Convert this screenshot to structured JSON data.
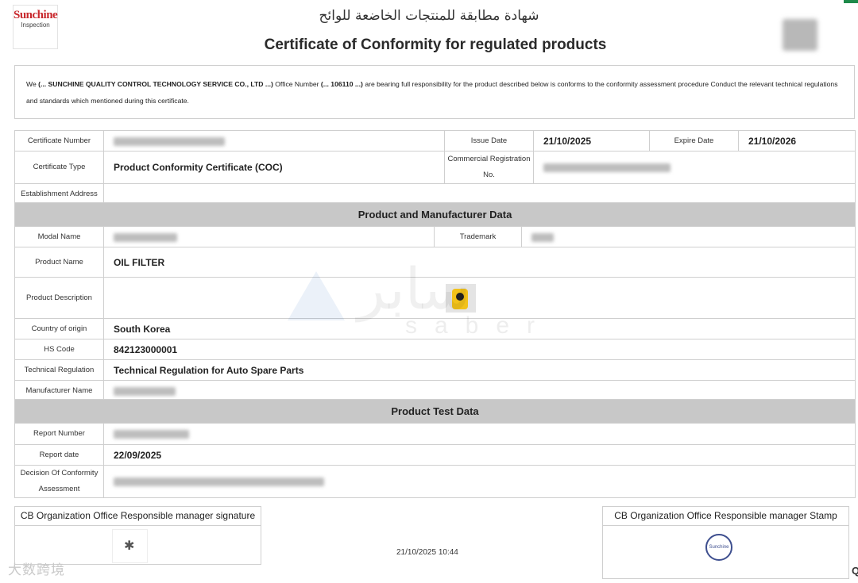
{
  "header": {
    "logo_line1": "Sunchine",
    "logo_line2": "Inspection",
    "title_ar": "شهادة مطابقة للمنتجات الخاضعة للوائح",
    "title_en": "Certificate of Conformity for regulated products"
  },
  "intro": {
    "we": "We",
    "company": "(... SUNCHINE QUALITY CONTROL TECHNOLOGY SERVICE CO., LTD ...)",
    "office_label": "Office Number",
    "office_number": "(... 106110 ...)",
    "text_rest": "are bearing full responsibility for the product described below is conforms to the conformity assessment procedure Conduct the relevant technical regulations and standards which mentioned during this certificate."
  },
  "certificate": {
    "number_label": "Certificate Number",
    "issue_date_label": "Issue Date",
    "issue_date": "21/10/2025",
    "expire_date_label": "Expire Date",
    "expire_date": "21/10/2026",
    "type_label": "Certificate Type",
    "type": "Product Conformity Certificate (COC)",
    "commercial_reg_label": "Commercial Registration No.",
    "address_label": "Establishment Address"
  },
  "product_section": {
    "title": "Product and Manufacturer Data",
    "model_label": "Modal Name",
    "trademark_label": "Trademark",
    "product_name_label": "Product Name",
    "product_name": "OIL FILTER",
    "description_label": "Product Description",
    "country_label": "Country of origin",
    "country": "South Korea",
    "hs_label": "HS Code",
    "hs_code": "842123000001",
    "regulation_label": "Technical Regulation",
    "regulation": "Technical Regulation for Auto Spare Parts",
    "manufacturer_label": "Manufacturer Name"
  },
  "test_section": {
    "title": "Product Test Data",
    "report_number_label": "Report Number",
    "report_date_label": "Report date",
    "report_date": "22/09/2025",
    "decision_label": "Decision Of Conformity Assessment"
  },
  "watermark": {
    "arabic": "سابر",
    "latin": "saber"
  },
  "signatures": {
    "signature_title": "CB Organization Office Responsible manager signature",
    "stamp_title": "CB Organization Office Responsible manager Stamp",
    "stamp_text": "Sunchine",
    "timestamp": "21/10/2025 10:44"
  },
  "footer": {
    "watermark_text": "大数跨境",
    "edge_char": "Q"
  }
}
